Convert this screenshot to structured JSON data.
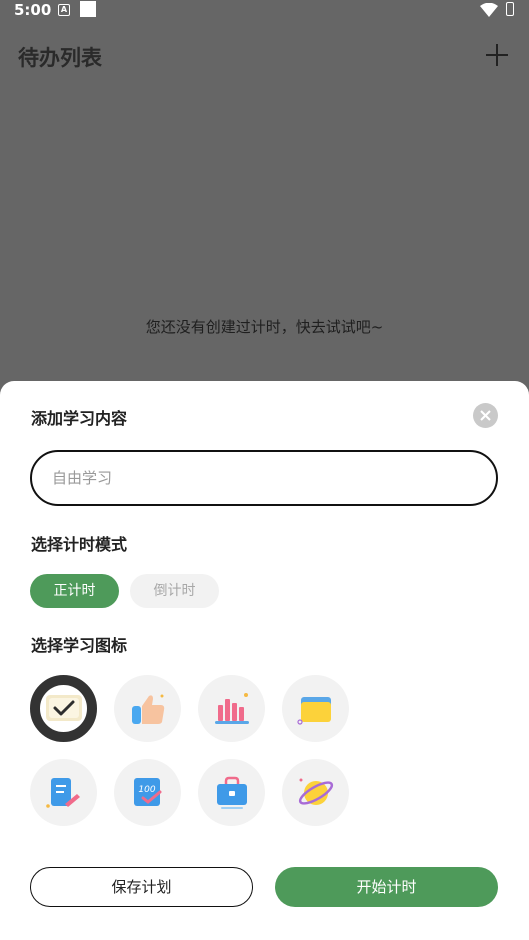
{
  "status_bar": {
    "time": "5:00",
    "notification_icon": "A"
  },
  "header": {
    "title": "待办列表",
    "add_icon": "plus-icon"
  },
  "empty_state": {
    "message": "您还没有创建过计时，快去试试吧~"
  },
  "sheet": {
    "title": "添加学习内容",
    "close_icon": "close-icon",
    "content_input": {
      "value": "",
      "placeholder": "自由学习"
    },
    "mode_section_label": "选择计时模式",
    "modes": [
      {
        "label": "正计时",
        "selected": true
      },
      {
        "label": "倒计时",
        "selected": false
      }
    ],
    "icon_section_label": "选择学习图标",
    "icons": [
      {
        "name": "check-screen-icon",
        "selected": true
      },
      {
        "name": "thumbs-up-icon",
        "selected": false
      },
      {
        "name": "bar-chart-icon",
        "selected": false
      },
      {
        "name": "folder-icon",
        "selected": false
      },
      {
        "name": "notebook-pen-icon",
        "selected": false
      },
      {
        "name": "score-100-icon",
        "selected": false
      },
      {
        "name": "briefcase-icon",
        "selected": false
      },
      {
        "name": "planet-icon",
        "selected": false
      }
    ],
    "save_label": "保存计划",
    "start_label": "开始计时"
  },
  "colors": {
    "accent": "#4e9a5a",
    "overlay": "#666666"
  }
}
